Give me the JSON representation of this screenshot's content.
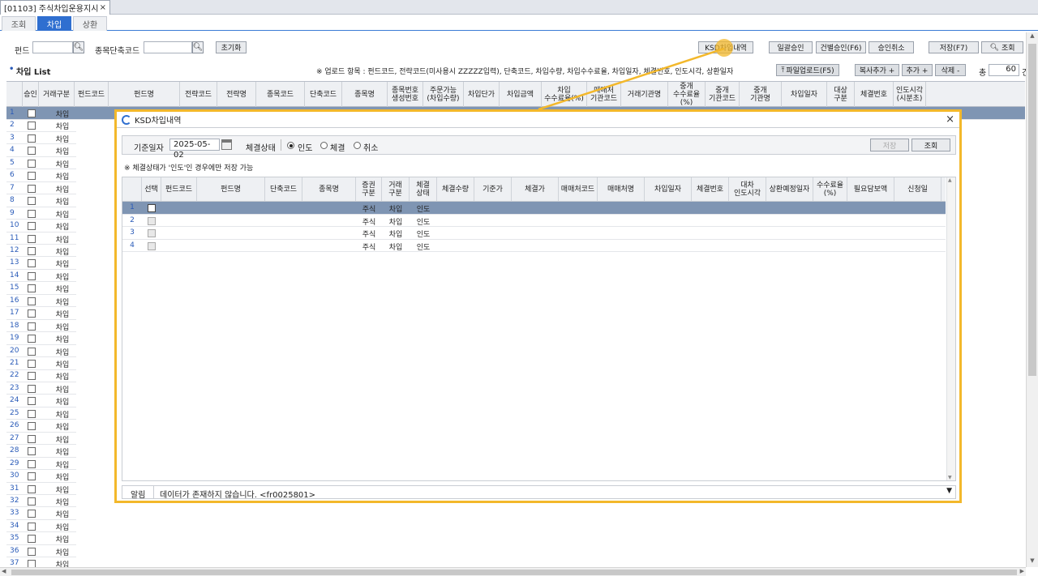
{
  "window_tab": {
    "title": "[01103] 주식차입운용지시",
    "close": "×"
  },
  "sub_tabs": [
    "조회",
    "차입",
    "상환"
  ],
  "search": {
    "fund_label": "펀드",
    "code_label": "종목단축코드",
    "reset_label": "초기화"
  },
  "toolbar": {
    "ksd_label": "KSD차입내역",
    "bulk_approve": "일괄승인",
    "each_approve": "건별승인(F6)",
    "cancel_approve": "승인취소",
    "save": "저장(F7)",
    "search": "조회"
  },
  "list": {
    "title": "차입 List",
    "upload_note": "※ 업로드 항목 : 펀드코드, 전략코드(미사용시 ZZZZZ입력), 단축코드, 차입수량, 차입수수료율, 차입일자, 체결번호, 인도시각, 상환일자",
    "file_upload": "파일업로드(F5)",
    "copy_add": "복사추가 +",
    "add": "추가 +",
    "delete": "삭제 -",
    "total_label": "총",
    "total_count": "60",
    "count_unit": "건"
  },
  "main_columns": [
    "승인",
    "거래구분",
    "펀드코드",
    "펀드명",
    "전략코드",
    "전략명",
    "종목코드",
    "단축코드",
    "종목명",
    "종목번호\n생성번호",
    "주문가능\n(차입수량)",
    "차입단가",
    "차입금액",
    "차입\n수수료율(%)",
    "매매처\n기관코드",
    "거래기관명",
    "중개\n수수료율(%)",
    "중개\n기관코드",
    "중개\n기관명",
    "차입일자",
    "대상\n구분",
    "체결번호",
    "인도시각\n(시분초)"
  ],
  "main_rows": {
    "trade_type": "차입",
    "numbers": [
      "1",
      "2",
      "3",
      "4",
      "5",
      "6",
      "7",
      "8",
      "9",
      "10",
      "11",
      "12",
      "13",
      "14",
      "15",
      "16",
      "17",
      "18",
      "19",
      "20",
      "21",
      "22",
      "23",
      "24",
      "25",
      "26",
      "27",
      "28",
      "29",
      "30",
      "31",
      "32",
      "33",
      "34",
      "35",
      "36",
      "37"
    ]
  },
  "popup": {
    "title": "KSD차입내역",
    "close": "×",
    "date_label": "기준일자",
    "date_value": "2025-05-02",
    "status_label": "체결상태",
    "radio_delivery": "인도",
    "radio_execution": "체결",
    "radio_cancel": "취소",
    "save": "저장",
    "search": "조회",
    "note": "※ 체결상태가 '인도'인 경우에만 저장 가능",
    "columns": [
      "선택",
      "펀드코드",
      "펀드명",
      "단축코드",
      "종목명",
      "증권\n구분",
      "거래\n구분",
      "체결\n상태",
      "체결수량",
      "기준가",
      "체결가",
      "매매처코드",
      "매매처명",
      "차입일자",
      "체결번호",
      "대차\n인도시각",
      "상환예정일자",
      "수수료율\n(%)",
      "필요담보액",
      "신청일"
    ],
    "rows": [
      {
        "num": "1",
        "sec": "주식",
        "trade": "차입",
        "status": "인도"
      },
      {
        "num": "2",
        "sec": "주식",
        "trade": "차입",
        "status": "인도"
      },
      {
        "num": "3",
        "sec": "주식",
        "trade": "차입",
        "status": "인도"
      },
      {
        "num": "4",
        "sec": "주식",
        "trade": "차입",
        "status": "인도"
      }
    ],
    "status_bar": {
      "label": "알림",
      "message": "데이터가 존재하지 않습니다. <fr0025801>"
    }
  }
}
